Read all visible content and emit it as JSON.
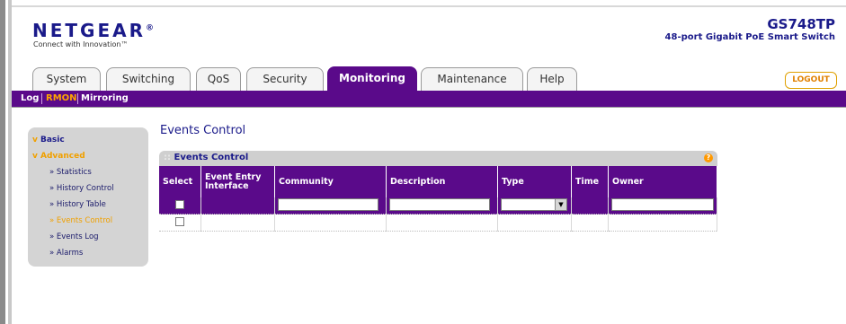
{
  "header": {
    "logo": "NETGEAR",
    "tagline": "Connect with Innovation™",
    "model": "GS748TP",
    "model_desc": "48-port Gigabit PoE Smart Switch"
  },
  "tabs": [
    {
      "label": "System"
    },
    {
      "label": "Switching"
    },
    {
      "label": "QoS"
    },
    {
      "label": "Security"
    },
    {
      "label": "Monitoring"
    },
    {
      "label": "Maintenance"
    },
    {
      "label": "Help"
    }
  ],
  "logout": "LOGOUT",
  "subnav": [
    "Log",
    "RMON",
    "Mirroring"
  ],
  "sidebar": {
    "basic": "Basic",
    "advanced": "Advanced",
    "items": [
      "» Statistics",
      "» History Control",
      "» History Table",
      "» Events Control",
      "» Events Log",
      "» Alarms"
    ]
  },
  "main": {
    "title": "Events Control",
    "panel_title": "Events Control",
    "help": "?",
    "columns": [
      "Select",
      "Event Entry Interface",
      "Community",
      "Description",
      "Type",
      "Time",
      "Owner"
    ]
  },
  "colors": {
    "brand": "#5a0a8a",
    "accent": "#ffa500",
    "text_blue": "#1a1a8a"
  },
  "icons": {
    "help": "help-icon",
    "arrow": "chevron-down-icon"
  }
}
